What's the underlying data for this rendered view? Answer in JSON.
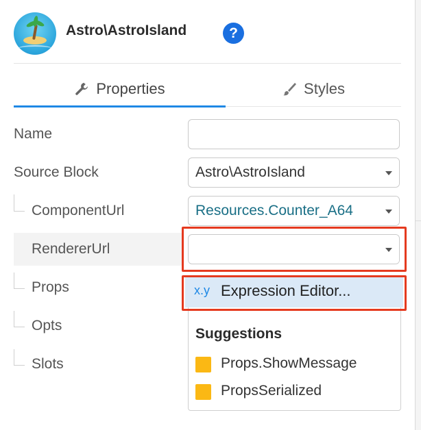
{
  "header": {
    "title": "Astro\\AstroIsland",
    "help_symbol": "?",
    "logo_icon": "tropical-island-icon"
  },
  "tabs": [
    {
      "label": "Properties",
      "icon": "wrench-icon",
      "active": true
    },
    {
      "label": "Styles",
      "icon": "brush-icon",
      "active": false
    }
  ],
  "fields": {
    "name": {
      "label": "Name",
      "value": ""
    },
    "source_block": {
      "label": "Source Block",
      "value": "Astro\\AstroIsland"
    },
    "component_url": {
      "label": "ComponentUrl",
      "value": "Resources.Counter_A64"
    },
    "renderer_url": {
      "label": "RendererUrl",
      "value": ""
    },
    "props": {
      "label": "Props"
    },
    "opts": {
      "label": "Opts"
    },
    "slots": {
      "label": "Slots"
    }
  },
  "dropdown": {
    "expression_icon_text": "x.y",
    "expression_label": "Expression Editor...",
    "suggestions_title": "Suggestions",
    "suggestions": [
      "Props.ShowMessage",
      "PropsSerialized"
    ]
  },
  "colors": {
    "accent": "#1e88e5",
    "highlight_border": "#e53a1f",
    "suggestion_marker": "#fbb814"
  }
}
